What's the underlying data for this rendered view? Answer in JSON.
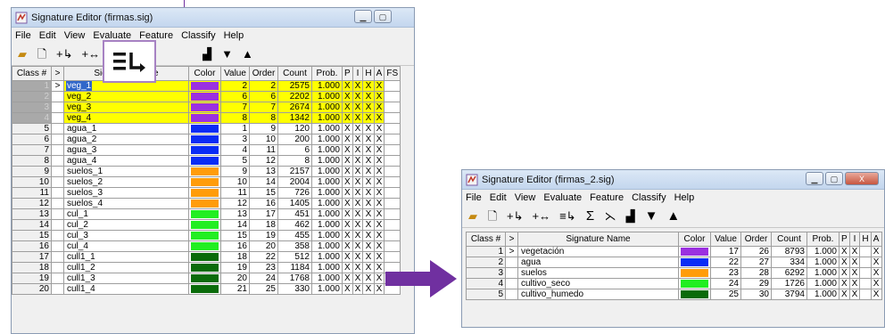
{
  "win1": {
    "title": "Signature Editor (firmas.sig)",
    "menu": [
      "File",
      "Edit",
      "View",
      "Evaluate",
      "Feature",
      "Classify",
      "Help"
    ],
    "toolbar": [
      "open-icon",
      "new-icon",
      "add-signature-icon",
      "replace-signature-icon",
      "merge-signatures-icon",
      "histogram-icon",
      "move-down-icon",
      "move-up-icon"
    ],
    "columns": [
      "Class #",
      ">",
      "Signature Name",
      "Color",
      "Value",
      "Order",
      "Count",
      "Prob.",
      "P",
      "I",
      "H",
      "A",
      "FS"
    ],
    "rows": [
      {
        "c": "1",
        "n": "veg_1",
        "v": "2",
        "o": "2",
        "ct": "2575",
        "p": "1.000",
        "col": "#9b30e0",
        "hl": true,
        "sel": true
      },
      {
        "c": "2",
        "n": "veg_2",
        "v": "6",
        "o": "6",
        "ct": "2202",
        "p": "1.000",
        "col": "#9b30e0",
        "hl": true
      },
      {
        "c": "3",
        "n": "veg_3",
        "v": "7",
        "o": "7",
        "ct": "2674",
        "p": "1.000",
        "col": "#9b30e0",
        "hl": true
      },
      {
        "c": "4",
        "n": "veg_4",
        "v": "8",
        "o": "8",
        "ct": "1342",
        "p": "1.000",
        "col": "#9b30e0",
        "hl": true
      },
      {
        "c": "5",
        "n": "agua_1",
        "v": "1",
        "o": "9",
        "ct": "120",
        "p": "1.000",
        "col": "#0a2cf5"
      },
      {
        "c": "6",
        "n": "agua_2",
        "v": "3",
        "o": "10",
        "ct": "200",
        "p": "1.000",
        "col": "#0a2cf5"
      },
      {
        "c": "7",
        "n": "agua_3",
        "v": "4",
        "o": "11",
        "ct": "6",
        "p": "1.000",
        "col": "#0a2cf5"
      },
      {
        "c": "8",
        "n": "agua_4",
        "v": "5",
        "o": "12",
        "ct": "8",
        "p": "1.000",
        "col": "#0a2cf5"
      },
      {
        "c": "9",
        "n": "suelos_1",
        "v": "9",
        "o": "13",
        "ct": "2157",
        "p": "1.000",
        "col": "#ff9c0a"
      },
      {
        "c": "10",
        "n": "suelos_2",
        "v": "10",
        "o": "14",
        "ct": "2004",
        "p": "1.000",
        "col": "#ff9c0a"
      },
      {
        "c": "11",
        "n": "suelos_3",
        "v": "11",
        "o": "15",
        "ct": "726",
        "p": "1.000",
        "col": "#ff9c0a"
      },
      {
        "c": "12",
        "n": "suelos_4",
        "v": "12",
        "o": "16",
        "ct": "1405",
        "p": "1.000",
        "col": "#ff9c0a"
      },
      {
        "c": "13",
        "n": "cul_1",
        "v": "13",
        "o": "17",
        "ct": "451",
        "p": "1.000",
        "col": "#22ee22"
      },
      {
        "c": "14",
        "n": "cul_2",
        "v": "14",
        "o": "18",
        "ct": "462",
        "p": "1.000",
        "col": "#22ee22"
      },
      {
        "c": "15",
        "n": "cul_3",
        "v": "15",
        "o": "19",
        "ct": "455",
        "p": "1.000",
        "col": "#22ee22"
      },
      {
        "c": "16",
        "n": "cul_4",
        "v": "16",
        "o": "20",
        "ct": "358",
        "p": "1.000",
        "col": "#22ee22"
      },
      {
        "c": "17",
        "n": "cull1_1",
        "v": "18",
        "o": "22",
        "ct": "512",
        "p": "1.000",
        "col": "#0a6b0a"
      },
      {
        "c": "18",
        "n": "cull1_2",
        "v": "19",
        "o": "23",
        "ct": "1184",
        "p": "1.000",
        "col": "#0a6b0a"
      },
      {
        "c": "19",
        "n": "cull1_3",
        "v": "20",
        "o": "24",
        "ct": "1768",
        "p": "1.000",
        "col": "#0a6b0a"
      },
      {
        "c": "20",
        "n": "cull1_4",
        "v": "21",
        "o": "25",
        "ct": "330",
        "p": "1.000",
        "col": "#0a6b0a"
      }
    ],
    "check": "X"
  },
  "win2": {
    "title": "Signature Editor (firmas_2.sig)",
    "menu": [
      "File",
      "Edit",
      "View",
      "Evaluate",
      "Feature",
      "Classify",
      "Help"
    ],
    "toolbar": [
      "open-icon",
      "new-icon",
      "add-signature-icon",
      "replace-signature-icon",
      "merge-signatures-icon",
      "sum-statistics-icon",
      "mean-plot-icon",
      "histogram-icon",
      "move-down-icon",
      "move-up-icon"
    ],
    "columns": [
      "Class #",
      ">",
      "Signature Name",
      "Color",
      "Value",
      "Order",
      "Count",
      "Prob.",
      "P",
      "I",
      "H",
      "A"
    ],
    "rows": [
      {
        "c": "1",
        "n": "vegetación",
        "v": "17",
        "o": "26",
        "ct": "8793",
        "p": "1.000",
        "col": "#9b30e0"
      },
      {
        "c": "2",
        "n": "agua",
        "v": "22",
        "o": "27",
        "ct": "334",
        "p": "1.000",
        "col": "#0a2cf5"
      },
      {
        "c": "3",
        "n": "suelos",
        "v": "23",
        "o": "28",
        "ct": "6292",
        "p": "1.000",
        "col": "#ff9c0a"
      },
      {
        "c": "4",
        "n": "cultivo_seco",
        "v": "24",
        "o": "29",
        "ct": "1726",
        "p": "1.000",
        "col": "#22ee22"
      },
      {
        "c": "5",
        "n": "cultivo_humedo",
        "v": "25",
        "o": "30",
        "ct": "3794",
        "p": "1.000",
        "col": "#0a6b0a"
      }
    ],
    "check": "X",
    "partial_close": "X"
  },
  "highlight_color": "#ffff00",
  "zoom_icon": "merge-signatures-icon",
  "arrow_color": "#7030a0"
}
